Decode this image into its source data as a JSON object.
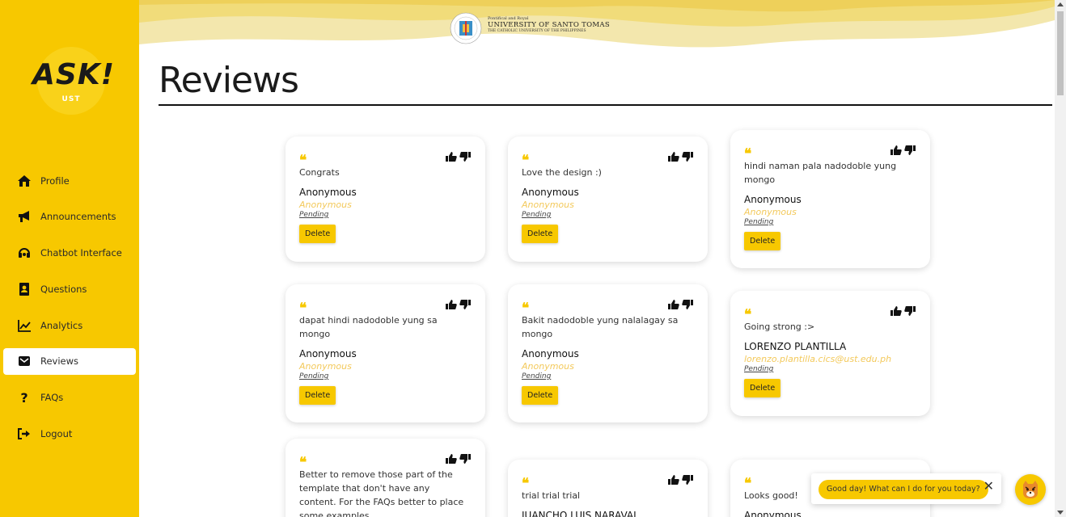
{
  "brand": {
    "logo_text": "ASK!",
    "logo_sub": "UST",
    "accent": "#f7c800"
  },
  "header": {
    "university_small": "Pontifical and Royal",
    "university_name": "UNIVERSITY OF SANTO TOMAS",
    "university_tagline": "THE CATHOLIC UNIVERSITY OF THE PHILIPPINES"
  },
  "page_title": "Reviews",
  "sidebar": {
    "items": [
      {
        "label": "Profile",
        "icon": "home-icon",
        "active": false
      },
      {
        "label": "Announcements",
        "icon": "megaphone-icon",
        "active": false
      },
      {
        "label": "Chatbot Interface",
        "icon": "headset-icon",
        "active": false
      },
      {
        "label": "Questions",
        "icon": "contact-book-icon",
        "active": false
      },
      {
        "label": "Analytics",
        "icon": "line-chart-icon",
        "active": false
      },
      {
        "label": "Reviews",
        "icon": "envelope-icon",
        "active": true
      },
      {
        "label": "FAQs",
        "icon": "question-icon",
        "active": false
      },
      {
        "label": "Logout",
        "icon": "logout-icon",
        "active": false
      }
    ]
  },
  "reviews": [
    {
      "text": "Congrats",
      "author": "Anonymous",
      "email": "Anonymous",
      "status": "Pending",
      "delete_label": "Delete"
    },
    {
      "text": "Love the design :)",
      "author": "Anonymous",
      "email": "Anonymous",
      "status": "Pending",
      "delete_label": "Delete"
    },
    {
      "text": "hindi naman pala nadodoble yung mongo",
      "author": "Anonymous",
      "email": "Anonymous",
      "status": "Pending",
      "delete_label": "Delete"
    },
    {
      "text": "dapat hindi nadodoble yung sa mongo",
      "author": "Anonymous",
      "email": "Anonymous",
      "status": "Pending",
      "delete_label": "Delete"
    },
    {
      "text": "Bakit nadodoble yung nalalagay sa mongo",
      "author": "Anonymous",
      "email": "Anonymous",
      "status": "Pending",
      "delete_label": "Delete"
    },
    {
      "text": "Going strong :>",
      "author": "LORENZO PLANTILLA",
      "email": "lorenzo.plantilla.cics@ust.edu.ph",
      "status": "Pending",
      "delete_label": "Delete"
    },
    {
      "text": "Better to remove those part of the template that don't have any content. For the FAQs better to place some examples.",
      "author": "",
      "email": "",
      "status": "",
      "delete_label": ""
    },
    {
      "text": "trial trial trial",
      "author": "JUANCHO LUIS NARAVAL",
      "email": "",
      "status": "",
      "delete_label": ""
    },
    {
      "text": "Looks good!",
      "author": "Anonymous",
      "email": "",
      "status": "",
      "delete_label": ""
    }
  ],
  "chat": {
    "greeting": "Good day! What can I do for you today?",
    "close_symbol": "✕"
  }
}
